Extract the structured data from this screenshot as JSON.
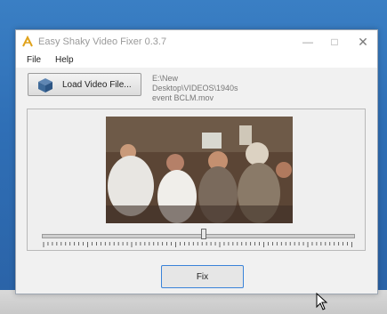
{
  "window": {
    "title": "Easy Shaky Video Fixer 0.3.7",
    "controls": {
      "minimize": "—",
      "maximize": "□",
      "close": "✕"
    }
  },
  "menu": {
    "items": [
      "File",
      "Help"
    ]
  },
  "toolbar": {
    "load_button_label": "Load Video File...",
    "load_icon": "open-file-icon"
  },
  "file": {
    "path_lines": [
      "E:\\New",
      "Desktop\\VIDEOS\\1940s",
      "event BCLM.mov"
    ]
  },
  "timeline": {
    "position_fraction": 0.52
  },
  "actions": {
    "fix_label": "Fix"
  },
  "colors": {
    "accent": "#3a83d9",
    "window_bg": "#f1f1f1"
  }
}
